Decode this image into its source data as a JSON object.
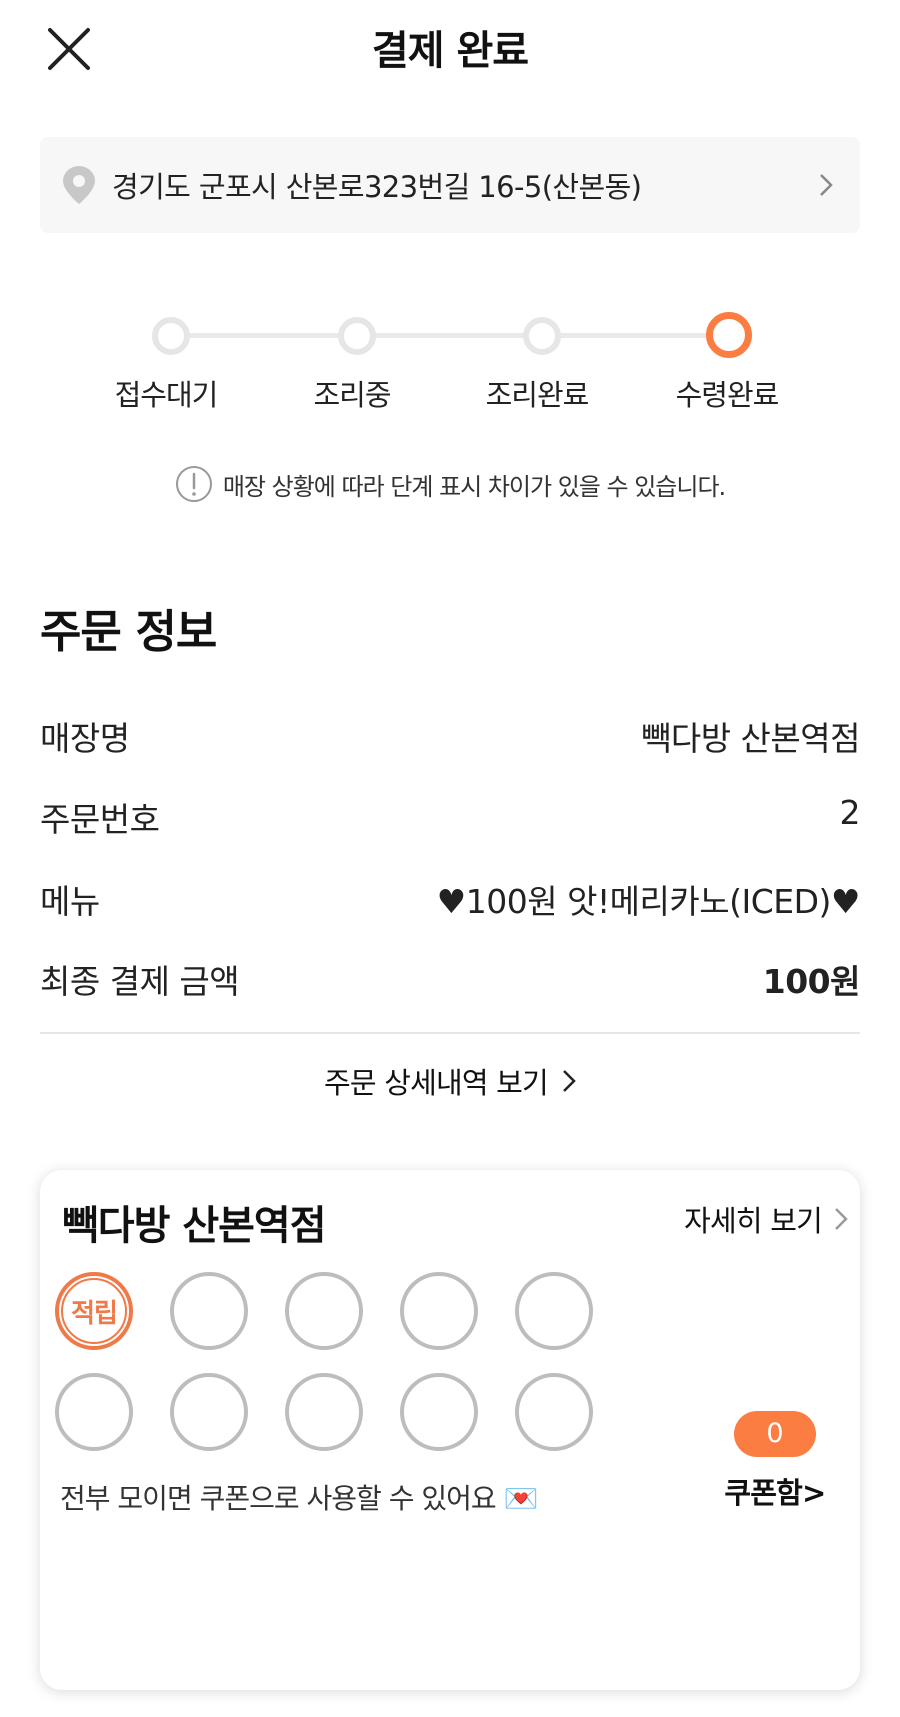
{
  "header": {
    "title": "결제 완료",
    "close_icon": "close-icon"
  },
  "address": {
    "text": "경기도 군포시 산본로323번길 16-5(산본동)",
    "icon": "location-pin-icon"
  },
  "progress": {
    "steps": [
      "접수대기",
      "조리중",
      "조리완료",
      "수령완료"
    ],
    "active_index": 3,
    "notice": "매장 상황에 따라 단계 표시 차이가 있을 수 있습니다."
  },
  "order": {
    "section_title": "주문 정보",
    "rows": [
      {
        "label": "매장명",
        "value": "빽다방 산본역점"
      },
      {
        "label": "주문번호",
        "value": "2"
      },
      {
        "label": "메뉴",
        "value": "♥100원 앗!메리카노(ICED)♥"
      },
      {
        "label": "최종 결제 금액",
        "value": "100원"
      }
    ],
    "detail_link": "주문 상세내역 보기"
  },
  "stamp_card": {
    "store": "빽다방 산본역점",
    "more_label": "자세히 보기",
    "stamp_text": "적립",
    "stamps_total": 10,
    "stamps_filled": 1,
    "coupon_count": "0",
    "coupon_label": "쿠폰함>",
    "note": "전부 모이면 쿠폰으로 사용할 수 있어요 💌"
  },
  "colors": {
    "accent": "#fb7d41",
    "stamp_accent": "#ef7a48",
    "inactive": "#e6e6e6"
  }
}
